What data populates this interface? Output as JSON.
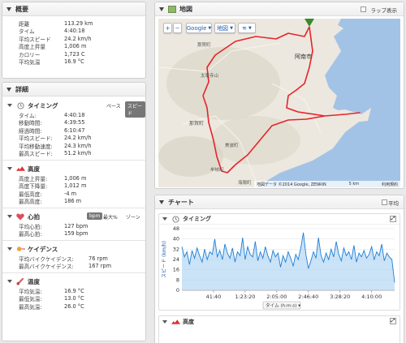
{
  "overview": {
    "title": "概要",
    "rows": [
      {
        "k": "距離",
        "v": "113.29 km"
      },
      {
        "k": "タイム",
        "v": "4:40:18"
      },
      {
        "k": "平均スピード",
        "v": "24.2 km/h"
      },
      {
        "k": "高度上昇量",
        "v": "1,006 m"
      },
      {
        "k": "カロリー",
        "v": "1,723 C"
      },
      {
        "k": "平均気温",
        "v": "16.9 °C"
      }
    ]
  },
  "details": {
    "title": "詳細",
    "timing": {
      "label": "タイミング",
      "toggle_pace": "ペース",
      "toggle_speed": "スピード",
      "rows": [
        {
          "k": "タイム:",
          "v": "4:40:18"
        },
        {
          "k": "移動時間:",
          "v": "4:39:55"
        },
        {
          "k": "経過時間:",
          "v": "6:10:47"
        },
        {
          "k": "平均スピード:",
          "v": "24.2 km/h"
        },
        {
          "k": "平均移動速度:",
          "v": "24.3 km/h"
        },
        {
          "k": "最高スピード:",
          "v": "51.2 km/h"
        }
      ]
    },
    "elevation": {
      "label": "高度",
      "rows": [
        {
          "k": "高度上昇量:",
          "v": "1,006 m"
        },
        {
          "k": "高度下降量:",
          "v": "1,012 m"
        },
        {
          "k": "最低高度:",
          "v": "-4 m"
        },
        {
          "k": "最高高度:",
          "v": "186 m"
        }
      ]
    },
    "heart": {
      "label": "心拍",
      "opt_bpm": "bpm",
      "opt_max": "最大%",
      "opt_zone": "ゾーン",
      "rows": [
        {
          "k": "平均心拍:",
          "v": "127 bpm"
        },
        {
          "k": "最高心拍:",
          "v": "159 bpm"
        }
      ]
    },
    "cadence": {
      "label": "ケイデンス",
      "rows": [
        {
          "k": "平均バイクケイデンス:",
          "v": "76 rpm"
        },
        {
          "k": "最高バイクケイデンス:",
          "v": "167 rpm"
        }
      ]
    },
    "temperature": {
      "label": "温度",
      "rows": [
        {
          "k": "平均気温:",
          "v": "16.9 °C"
        },
        {
          "k": "最低気温:",
          "v": "13.0 °C"
        },
        {
          "k": "最高気温:",
          "v": "26.0 °C"
        }
      ]
    }
  },
  "map": {
    "title": "地図",
    "lap_label": "ラップ表示",
    "zoom_in": "+",
    "zoom_out": "−",
    "btn_google": "Google",
    "btn_map": "地図",
    "attribution": "地図データ ©2014 Google, ZENRIN",
    "scale": "5 km",
    "terms": "利用規約",
    "labels": [
      "那賀町",
      "阿南市",
      "那賀町",
      "美波町",
      "牟岐町",
      "海陽町",
      "太竜寺山"
    ]
  },
  "chart_panel": {
    "title": "チャート",
    "avg_label": "平均",
    "timing_label": "タイミング",
    "elevation_label": "高度",
    "x_axis_button": "タイム (h:m:s)"
  },
  "chart_data": {
    "type": "area",
    "title": "",
    "ylabel": "スピード (km/h)",
    "xlabel": "タイム (h:m:s)",
    "ylim": [
      0,
      48
    ],
    "yticks": [
      0,
      8,
      16,
      24,
      32,
      40,
      48
    ],
    "xticks": [
      "41:40",
      "1:23:20",
      "2:05:00",
      "2:46:40",
      "3:28:20",
      "4:10:00"
    ],
    "xtick_seconds": [
      2500,
      5000,
      7500,
      10000,
      12500,
      15000
    ],
    "xlim": [
      0,
      16818
    ],
    "series": [
      {
        "x": [
          0,
          200,
          400,
          600,
          800,
          1000,
          1200,
          1400,
          1600,
          1800,
          2000,
          2200,
          2400,
          2600,
          2800,
          3000,
          3200,
          3400,
          3600,
          3800,
          4000,
          4200,
          4400,
          4600,
          4800,
          5000,
          5200,
          5400,
          5600,
          5800,
          6000,
          6200,
          6400,
          6600,
          6800,
          7000,
          7200,
          7400,
          7600,
          7800,
          8000,
          8200,
          8400,
          8600,
          8800,
          9000,
          9200,
          9400,
          9600,
          9800,
          10000,
          10200,
          10400,
          10600,
          10800,
          11000,
          11200,
          11400,
          11600,
          11800,
          12000,
          12200,
          12400,
          12600,
          12800,
          13000,
          13200,
          13400,
          13600,
          13800,
          14000,
          14200,
          14400,
          14600,
          14800,
          15000,
          15200,
          15400,
          15600,
          15800,
          16000,
          16200,
          16400,
          16600,
          16818
        ],
        "y": [
          34,
          26,
          30,
          20,
          31,
          25,
          33,
          27,
          22,
          32,
          24,
          30,
          28,
          40,
          26,
          31,
          24,
          36,
          29,
          25,
          33,
          22,
          30,
          27,
          41,
          24,
          34,
          28,
          26,
          38,
          23,
          30,
          25,
          34,
          27,
          22,
          31,
          26,
          29,
          18,
          27,
          22,
          30,
          25,
          19,
          28,
          24,
          33,
          45,
          28,
          17,
          23,
          30,
          25,
          41,
          27,
          22,
          29,
          24,
          32,
          26,
          38,
          28,
          23,
          33,
          27,
          30,
          24,
          35,
          22,
          29,
          26,
          31,
          25,
          28,
          34,
          24,
          30,
          27,
          36,
          23,
          29,
          26,
          24,
          6
        ]
      }
    ]
  },
  "colors": {
    "route": "#e8232a",
    "chart_line": "#1e7fd6",
    "chart_fill": "#a9d0f2",
    "map_land": "#ece8df",
    "map_sea": "#a3c3e6"
  }
}
